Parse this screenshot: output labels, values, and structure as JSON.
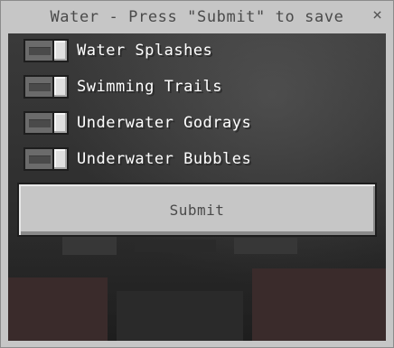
{
  "dialog": {
    "title": "Water - Press \"Submit\" to save",
    "close_glyph": "×"
  },
  "toggles": [
    {
      "label": "Water Splashes",
      "checked": true
    },
    {
      "label": "Swimming Trails",
      "checked": true
    },
    {
      "label": "Underwater Godrays",
      "checked": true
    },
    {
      "label": "Underwater Bubbles",
      "checked": true
    }
  ],
  "submit": {
    "label": "Submit"
  },
  "colors": {
    "frame": "#c6c6c6",
    "toggle_on_knob": "#e0e0e0",
    "label_text": "#ffffff"
  },
  "icons": {
    "close": "close-icon"
  }
}
